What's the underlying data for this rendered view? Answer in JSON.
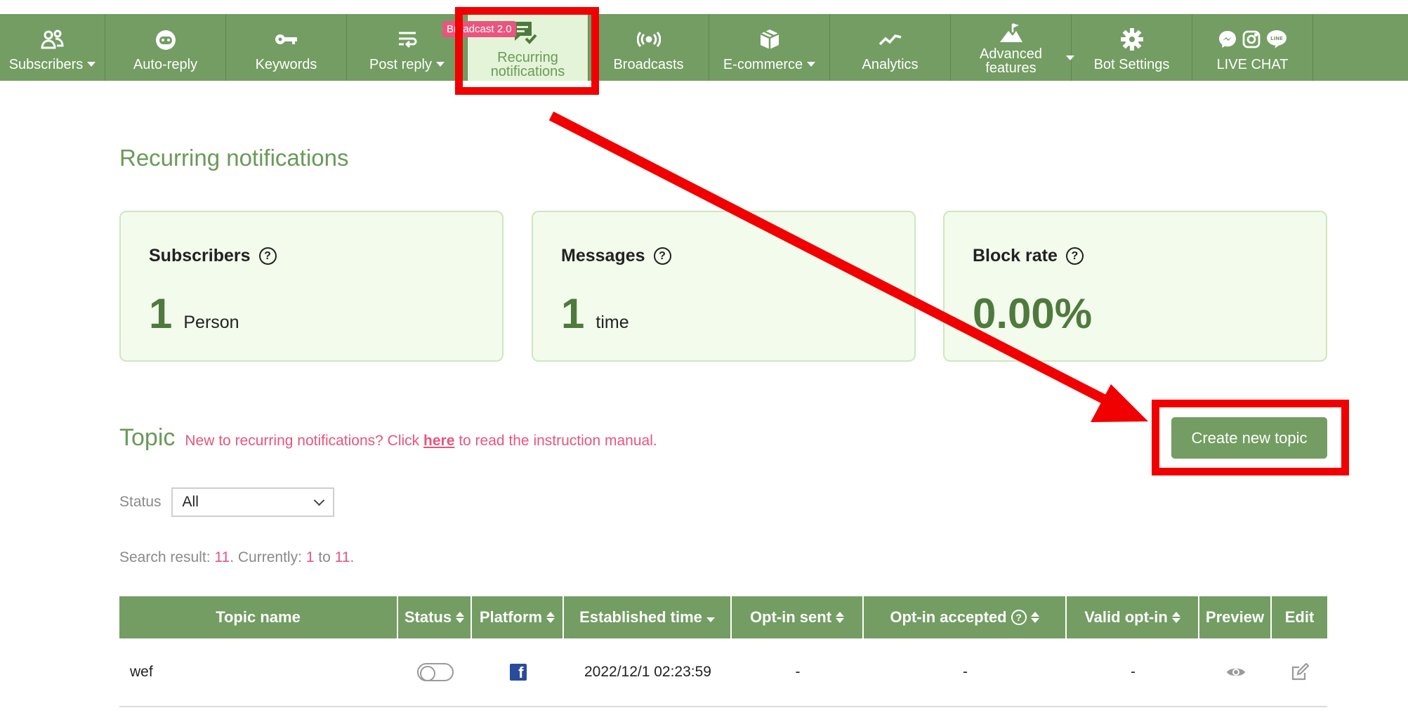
{
  "nav": {
    "items": [
      {
        "label": "Subscribers",
        "icon": "subscribers-icon",
        "dropdown": true
      },
      {
        "label": "Auto-reply",
        "icon": "robot-icon",
        "dropdown": false
      },
      {
        "label": "Keywords",
        "icon": "key-icon",
        "dropdown": false
      },
      {
        "label": "Post reply",
        "icon": "post-reply-icon",
        "dropdown": true
      },
      {
        "label_line1": "Recurring",
        "label_line2": "notifications",
        "icon": "message-check-icon",
        "active": true,
        "badge": "Broadcast 2.0"
      },
      {
        "label": "Broadcasts",
        "icon": "broadcast-icon",
        "dropdown": false
      },
      {
        "label": "E-commerce",
        "icon": "box-icon",
        "dropdown": true
      },
      {
        "label": "Analytics",
        "icon": "analytics-icon",
        "dropdown": false
      },
      {
        "label_line1": "Advanced",
        "label_line2": "features",
        "icon": "mountain-flag-icon",
        "dropdown": true
      },
      {
        "label": "Bot Settings",
        "icon": "gear-icon",
        "dropdown": false
      },
      {
        "label": "LIVE CHAT",
        "icon": "messenger-instagram-line-icon",
        "dropdown": false
      }
    ]
  },
  "page": {
    "title": "Recurring notifications"
  },
  "stats": {
    "subscribers": {
      "title": "Subscribers",
      "value": "1",
      "unit": "Person"
    },
    "messages": {
      "title": "Messages",
      "value": "1",
      "unit": "time"
    },
    "block_rate": {
      "title": "Block rate",
      "value": "0.00%"
    }
  },
  "topic": {
    "heading": "Topic",
    "help_prefix": "New to recurring notifications? Click ",
    "help_link": "here",
    "help_suffix": " to read the instruction manual.",
    "create_button": "Create new topic"
  },
  "filter": {
    "status_label": "Status",
    "status_value": "All"
  },
  "search": {
    "prefix": "Search result: ",
    "total": "11",
    "mid": ". Currently: ",
    "from": "1",
    "to_word": " to ",
    "to": "11",
    "suffix": "."
  },
  "table": {
    "headers": {
      "topic_name": "Topic name",
      "status": "Status",
      "platform": "Platform",
      "established": "Established time",
      "optin_sent": "Opt-in sent",
      "optin_accepted": "Opt-in accepted",
      "valid_optin": "Valid opt-in",
      "preview": "Preview",
      "edit": "Edit"
    },
    "rows": [
      {
        "topic_name": "wef",
        "status": "off",
        "platform": "facebook",
        "established": "2022/12/1 02:23:59",
        "optin_sent": "-",
        "optin_accepted": "-",
        "valid_optin": "-"
      }
    ]
  },
  "colors": {
    "nav_green": "#739d62",
    "active_bg": "#e4f4d8",
    "accent_pink": "#e8557e",
    "annotation_red": "#f00000",
    "card_bg": "#f3fbec"
  }
}
